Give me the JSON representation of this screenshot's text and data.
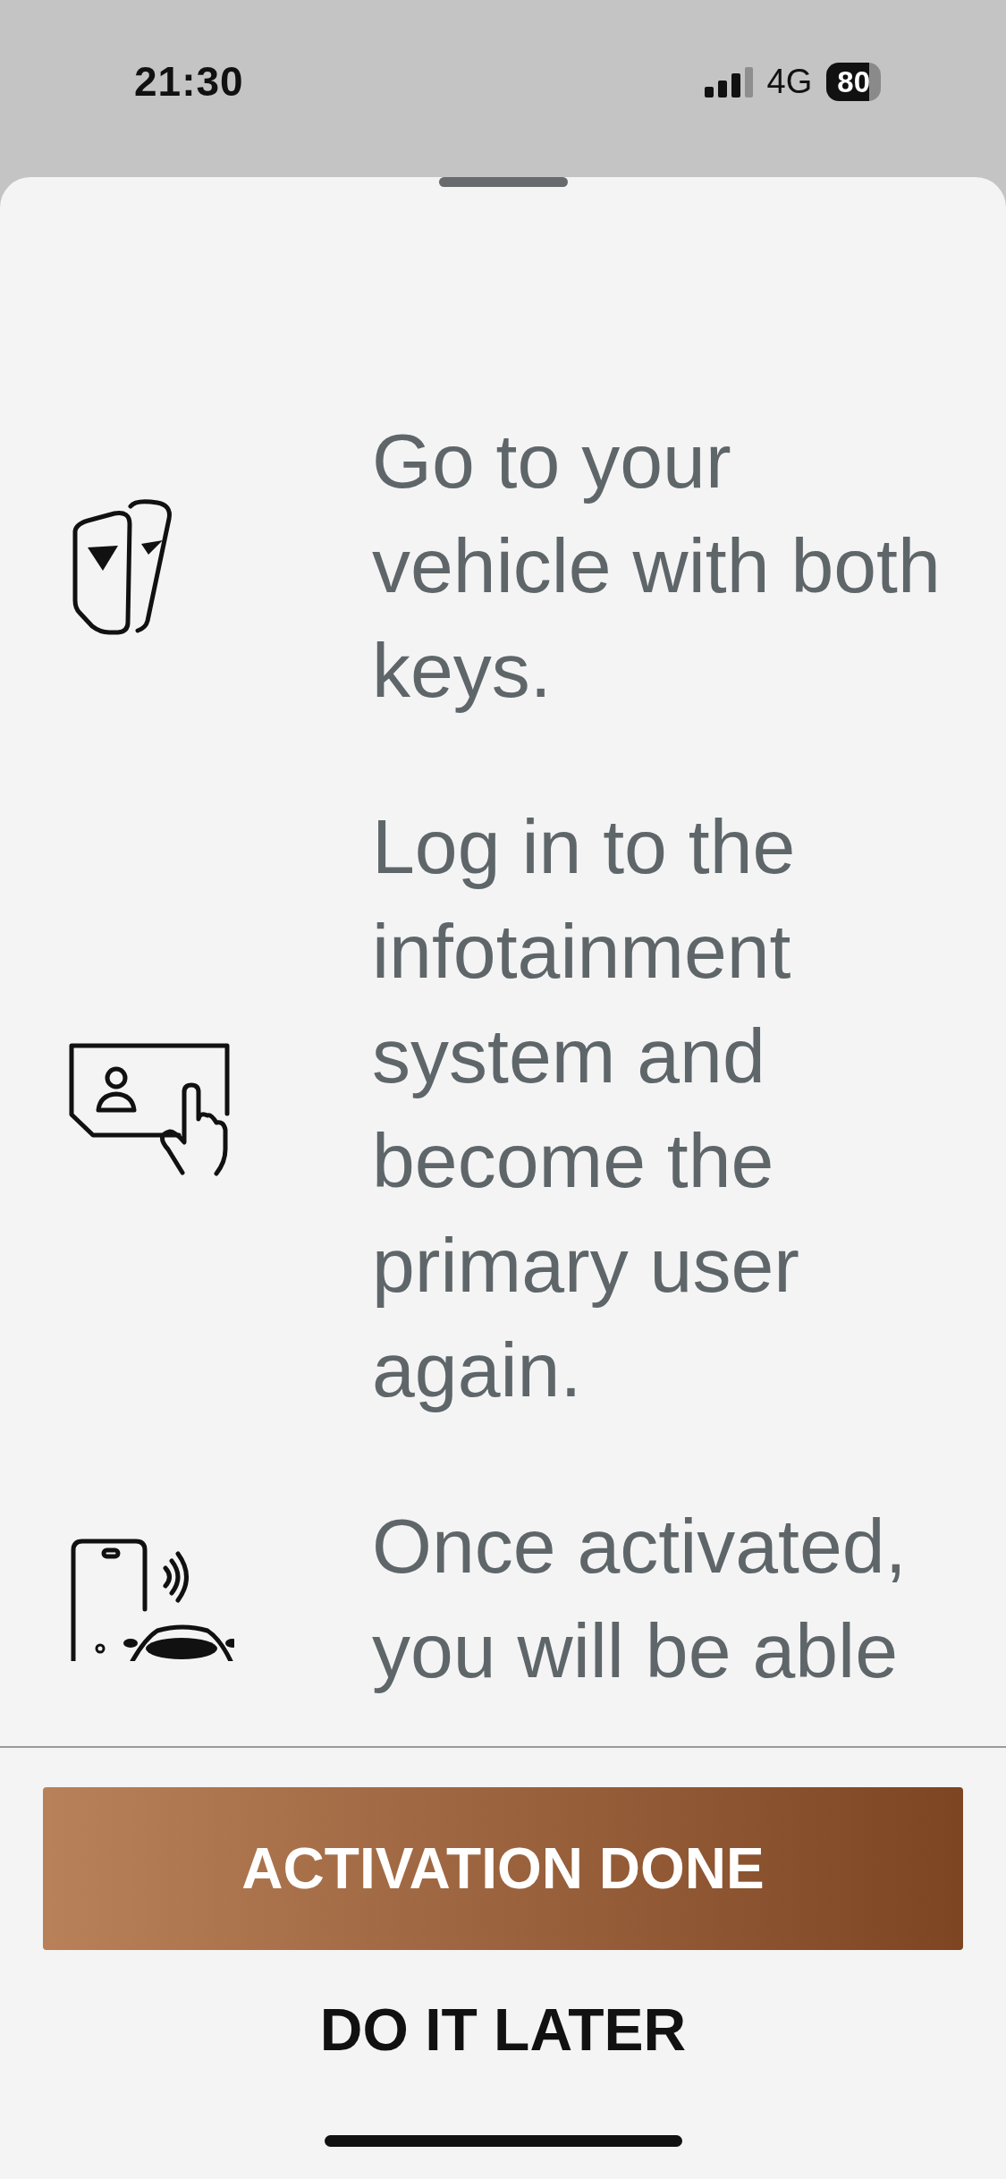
{
  "status_bar": {
    "time": "21:30",
    "network": "4G",
    "battery": "80"
  },
  "steps": [
    {
      "kind": "keys",
      "text": "Go to your vehicle with both keys."
    },
    {
      "kind": "screen",
      "text": "Log in to the infotainment system and become the primary user again."
    },
    {
      "kind": "phone",
      "text": "Once activated, you will be able"
    }
  ],
  "primary_button": "ACTIVATION DONE",
  "secondary_button": "DO IT LATER"
}
